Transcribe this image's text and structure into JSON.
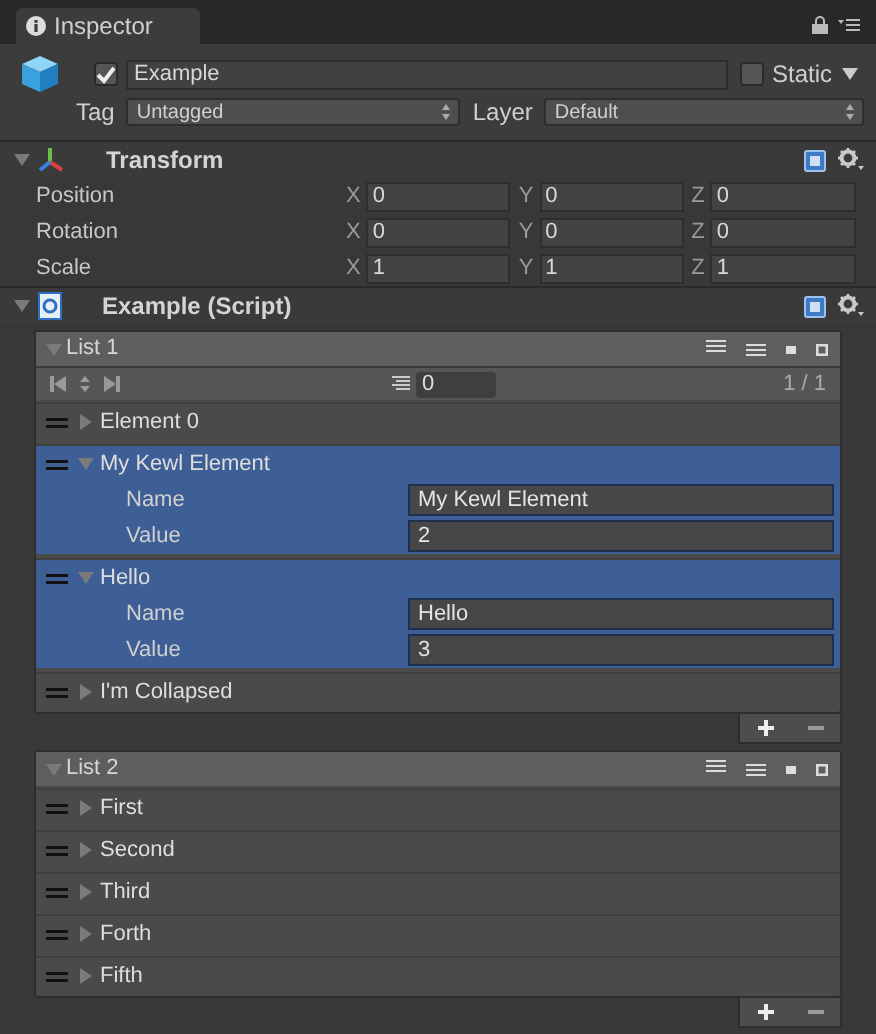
{
  "tab": {
    "label": "Inspector"
  },
  "object": {
    "active": true,
    "name": "Example",
    "static": false,
    "static_label": "Static",
    "tag_label": "Tag",
    "tag": "Untagged",
    "layer_label": "Layer",
    "layer": "Default"
  },
  "components": [
    {
      "kind": "transform",
      "title": "Transform",
      "expanded": true,
      "rows": [
        {
          "label": "Position",
          "fields": [
            {
              "axis": "X",
              "value": "0"
            },
            {
              "axis": "Y",
              "value": "0"
            },
            {
              "axis": "Z",
              "value": "0"
            }
          ]
        },
        {
          "label": "Rotation",
          "fields": [
            {
              "axis": "X",
              "value": "0"
            },
            {
              "axis": "Y",
              "value": "0"
            },
            {
              "axis": "Z",
              "value": "0"
            }
          ]
        },
        {
          "label": "Scale",
          "fields": [
            {
              "axis": "X",
              "value": "1"
            },
            {
              "axis": "Y",
              "value": "1"
            },
            {
              "axis": "Z",
              "value": "1"
            }
          ]
        }
      ]
    },
    {
      "kind": "script",
      "title": "Example (Script)",
      "expanded": true,
      "lists": [
        {
          "title": "List 1",
          "expanded": true,
          "pagination": {
            "page_size": "0",
            "page": "1 / 1"
          },
          "items": [
            {
              "label": "Element 0",
              "expanded": false,
              "selected": false
            },
            {
              "label": "My Kewl Element",
              "expanded": true,
              "selected": true,
              "fields": [
                {
                  "label": "Name",
                  "value": "My Kewl Element"
                },
                {
                  "label": "Value",
                  "value": "2"
                }
              ]
            },
            {
              "label": "Hello",
              "expanded": true,
              "selected": true,
              "fields": [
                {
                  "label": "Name",
                  "value": "Hello"
                },
                {
                  "label": "Value",
                  "value": "3"
                }
              ]
            },
            {
              "label": "I'm Collapsed",
              "expanded": false,
              "selected": false
            }
          ]
        },
        {
          "title": "List 2",
          "expanded": true,
          "items": [
            {
              "label": "First",
              "expanded": false,
              "selected": false
            },
            {
              "label": "Second",
              "expanded": false,
              "selected": false
            },
            {
              "label": "Third",
              "expanded": false,
              "selected": false
            },
            {
              "label": "Forth",
              "expanded": false,
              "selected": false
            },
            {
              "label": "Fifth",
              "expanded": false,
              "selected": false
            }
          ]
        }
      ]
    }
  ]
}
